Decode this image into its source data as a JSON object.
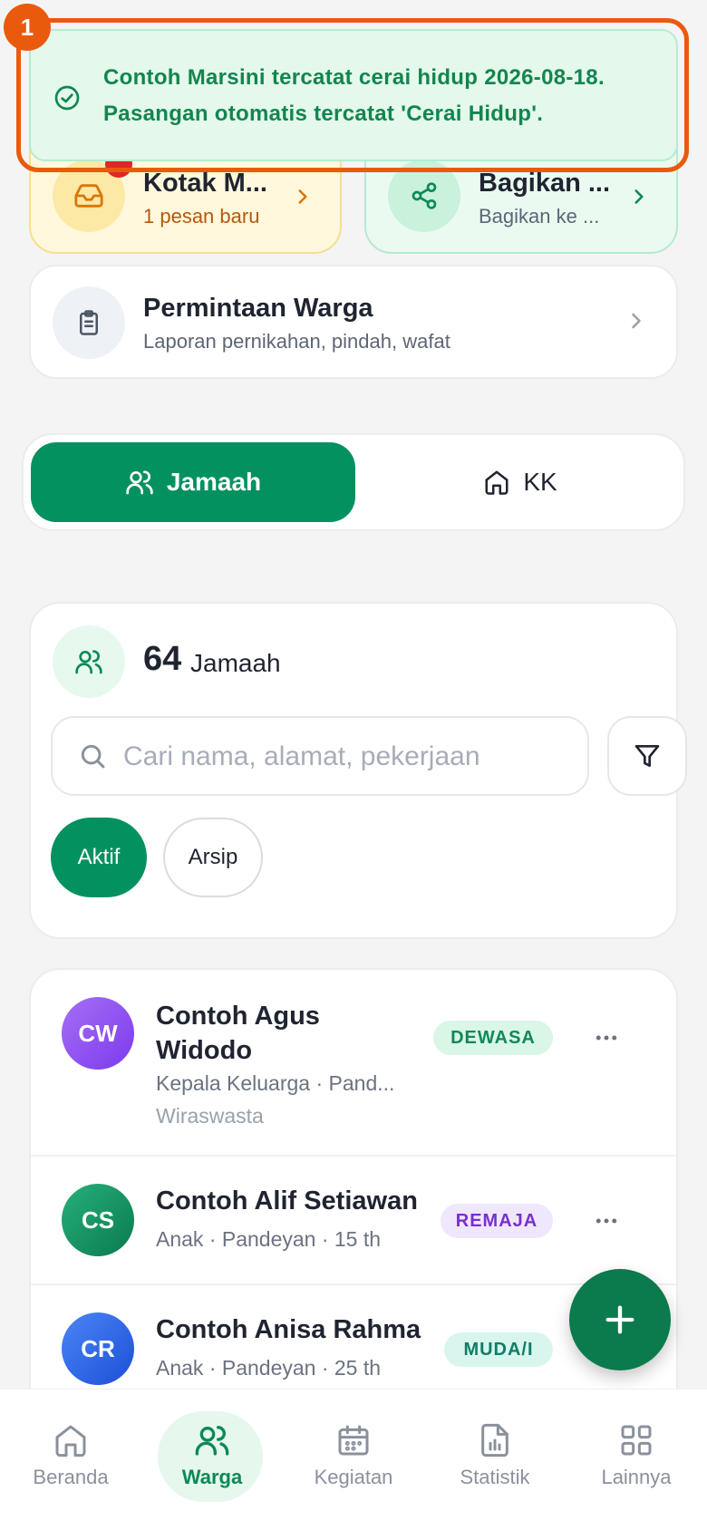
{
  "quick_cards": {
    "inbox": {
      "title": "Kotak M...",
      "subtitle": "1 pesan baru"
    },
    "share": {
      "title": "Bagikan ...",
      "subtitle": "Bagikan ke ..."
    }
  },
  "request_card": {
    "title": "Permintaan Warga",
    "subtitle": "Laporan pernikahan, pindah, wafat"
  },
  "tabs": {
    "active": "Jamaah",
    "inactive": "KK"
  },
  "summary": {
    "count": "64",
    "label": "Jamaah",
    "search_placeholder": "Cari nama, alamat, pekerjaan",
    "chips": [
      "Aktif",
      "Arsip"
    ]
  },
  "members": [
    {
      "initials": "CW",
      "name": "Contoh Agus Widodo",
      "sub": "Kepala Keluarga · Pand...",
      "sub2": "Wiraswasta",
      "badge": "DEWASA",
      "avatar_color": "#8b5cf6",
      "badge_bg": "#d9f6e6",
      "badge_fg": "#13875a"
    },
    {
      "initials": "CS",
      "name": "Contoh Alif Setiawan",
      "sub": "Anak · Pandeyan · 15 th",
      "badge": "REMAJA",
      "avatar_color": "#14915f",
      "badge_bg": "#efe7fd",
      "badge_fg": "#7a2fd0"
    },
    {
      "initials": "CR",
      "name": "Contoh Anisa Rahma",
      "sub": "Anak · Pandeyan · 25 th",
      "badge": "MUDA/I",
      "avatar_color": "#2f6ee8",
      "badge_bg": "#d8f6ee",
      "badge_fg": "#0f7e66"
    }
  ],
  "toast": {
    "number": "1",
    "message": "Contoh Marsini tercatat cerai hidup 2026-08-18. Pasangan otomatis tercatat 'Cerai Hidup'."
  },
  "bottom_nav": [
    {
      "label": "Beranda",
      "icon": "home-icon"
    },
    {
      "label": "Warga",
      "icon": "users-icon",
      "active": true
    },
    {
      "label": "Kegiatan",
      "icon": "calendar-icon"
    },
    {
      "label": "Statistik",
      "icon": "stats-file-icon"
    },
    {
      "label": "Lainnya",
      "icon": "grid-icon"
    }
  ],
  "colors": {
    "primary": "#039160",
    "toast_border": "#ea5a0c",
    "toast_bg": "#e4f8ec"
  }
}
